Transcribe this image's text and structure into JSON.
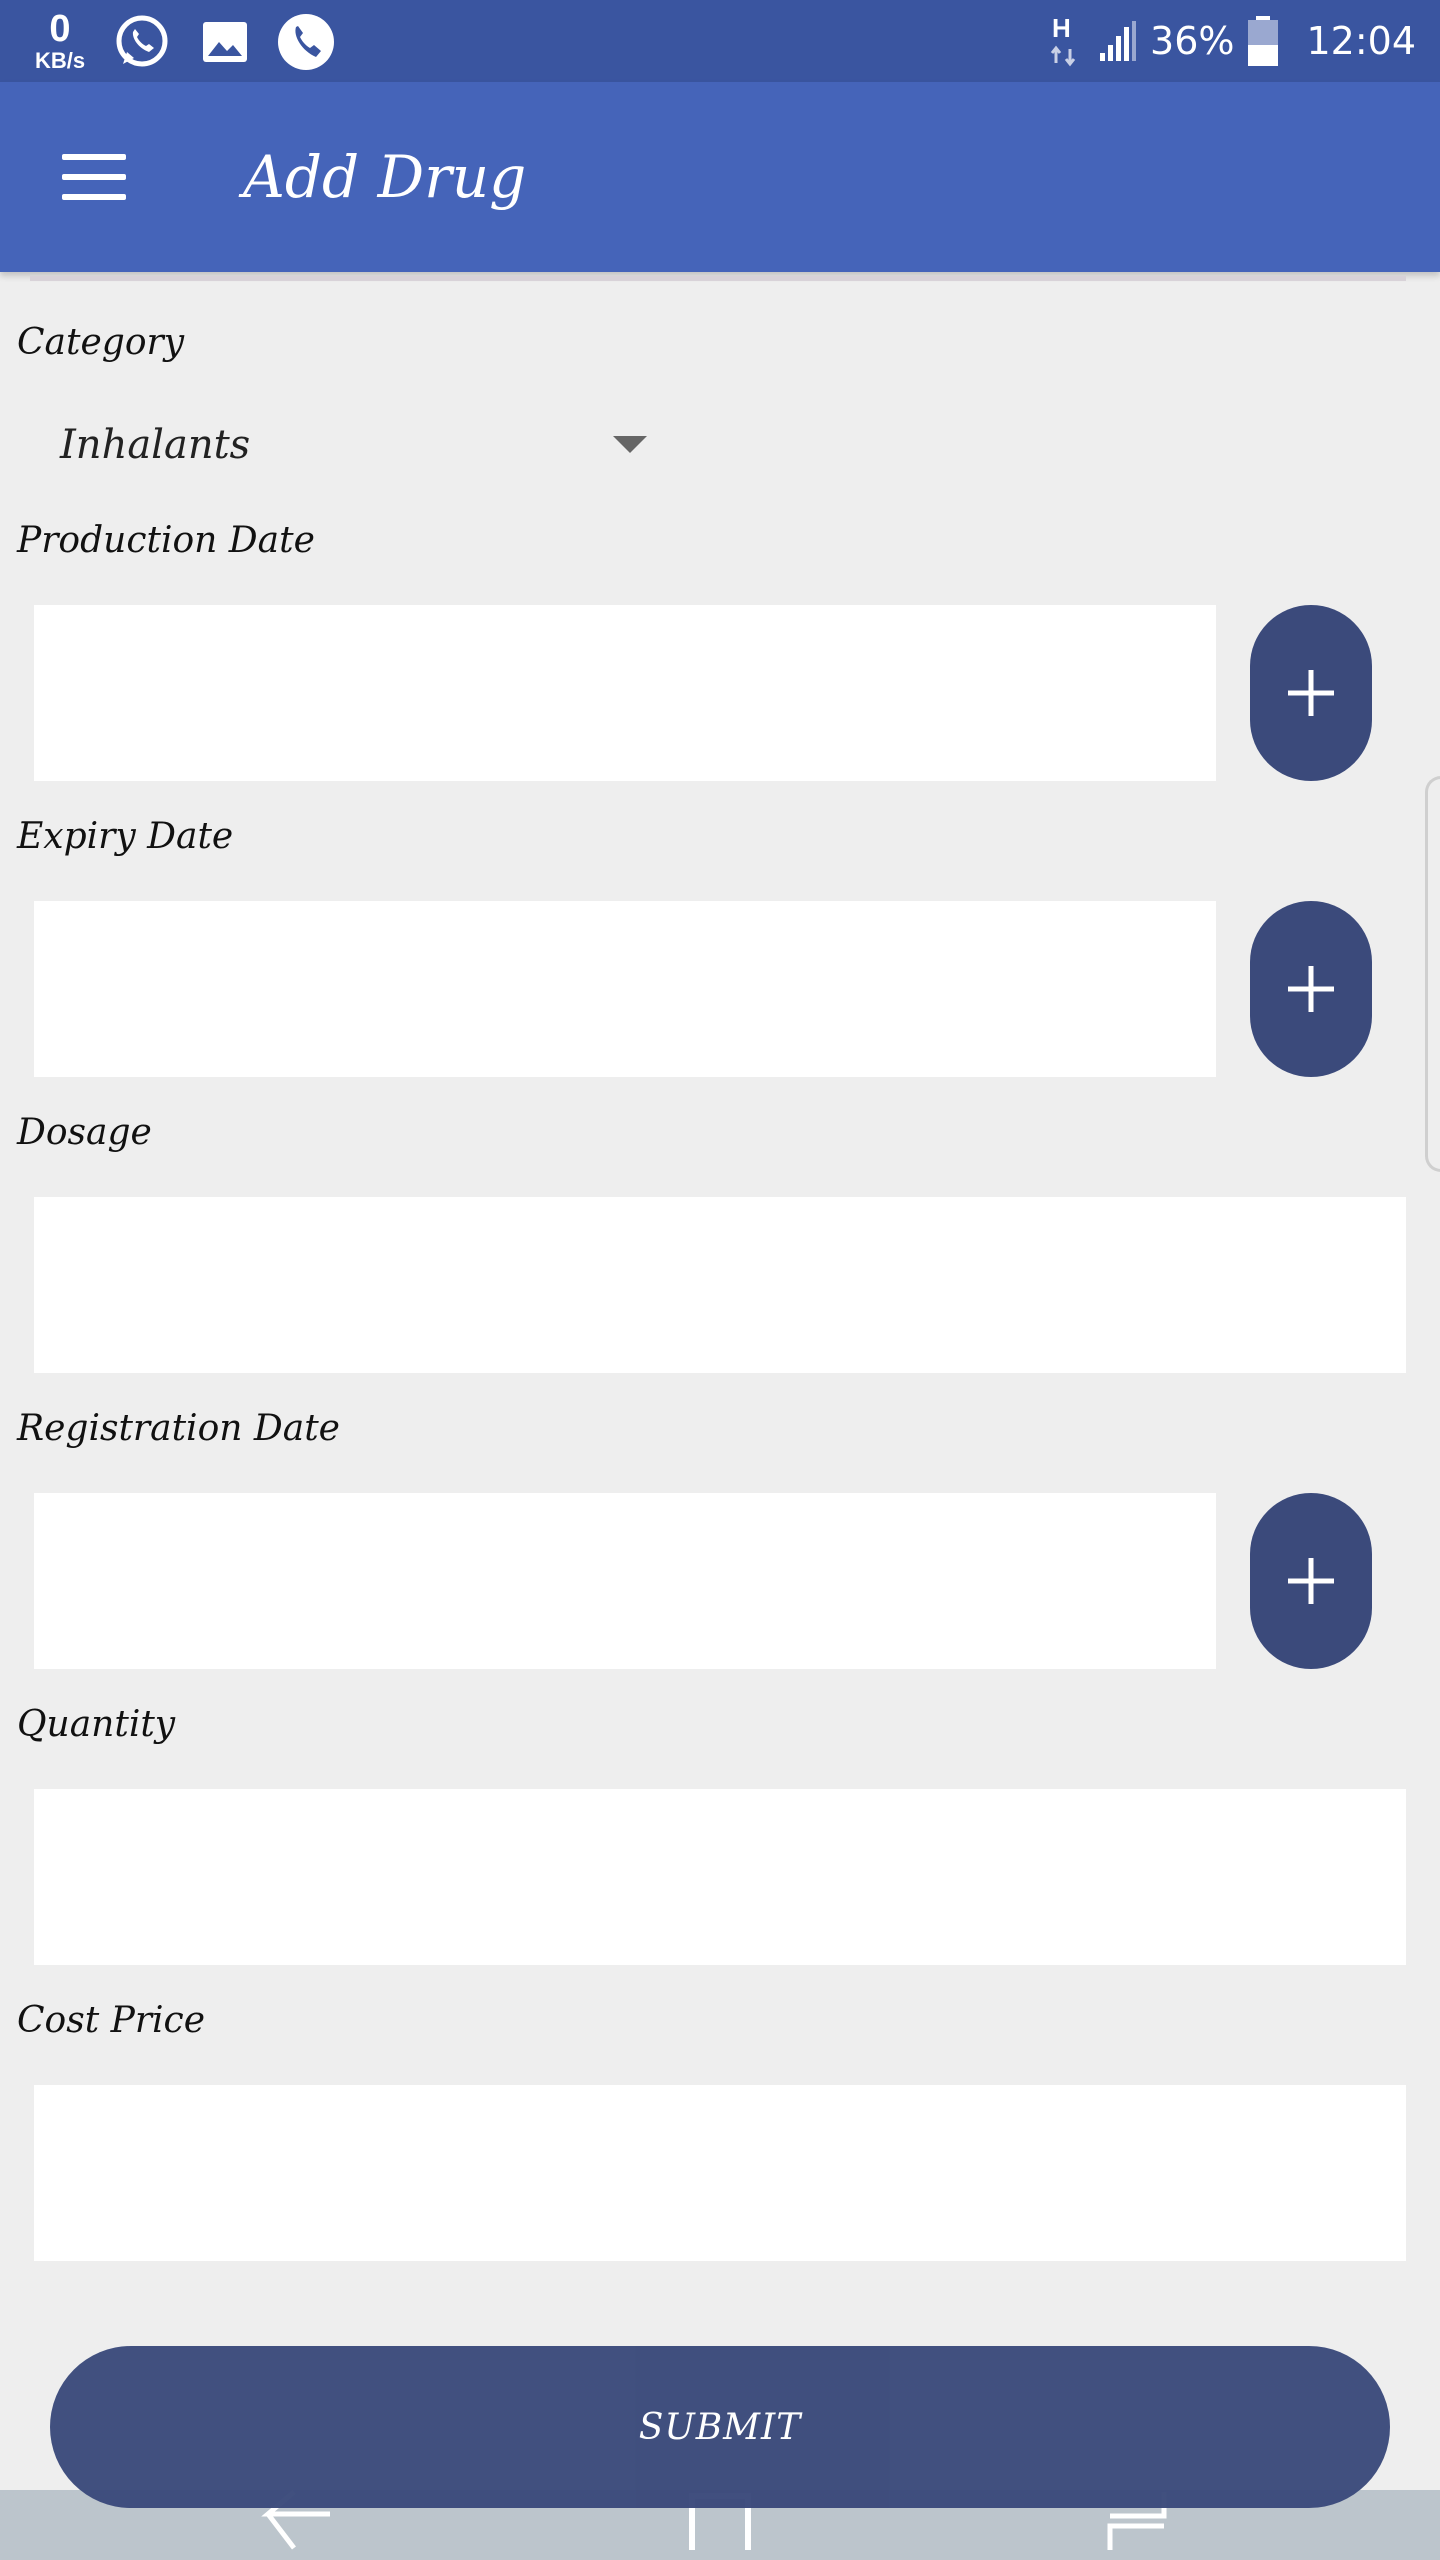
{
  "status_bar": {
    "data_rate": "0",
    "data_rate_unit": "KB/s",
    "network_type": "H",
    "battery": "36%",
    "time": "12:04"
  },
  "app_bar": {
    "title": "Add Drug"
  },
  "form": {
    "category": {
      "label": "Category",
      "selected": "Inhalants"
    },
    "production_date": {
      "label": "Production Date",
      "value": ""
    },
    "expiry_date": {
      "label": "Expiry Date",
      "value": ""
    },
    "dosage": {
      "label": "Dosage",
      "value": ""
    },
    "registration_date": {
      "label": "Registration Date",
      "value": ""
    },
    "quantity": {
      "label": "Quantity",
      "value": ""
    },
    "cost_price": {
      "label": "Cost Price",
      "value": ""
    }
  },
  "submit_label": "SUBMIT",
  "colors": {
    "status_bar": "#3a55a0",
    "app_bar": "#4564b9",
    "accent_button": "#3b4a7b",
    "background": "#eeeeee"
  }
}
